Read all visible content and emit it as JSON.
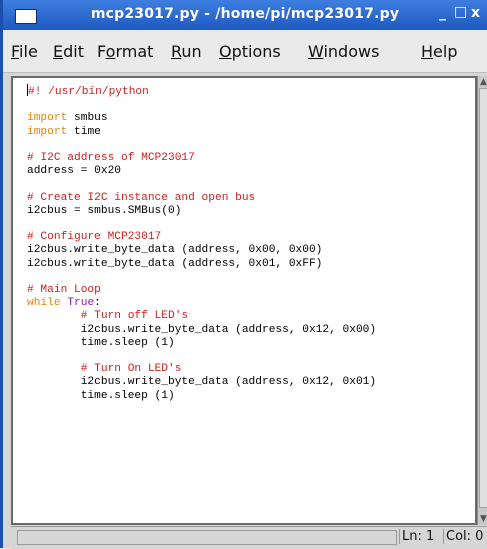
{
  "window": {
    "title": "mcp23017.py - /home/pi/mcp23017.py",
    "controls": {
      "minimize": "_",
      "maximize": "□",
      "close": "x"
    }
  },
  "menu": [
    {
      "label_rest": "ile",
      "mnemonic": "F"
    },
    {
      "label_rest": "dit",
      "mnemonic": "E"
    },
    {
      "label_pre": "F",
      "mnemonic": "o",
      "label_rest": "rmat"
    },
    {
      "label_rest": "un",
      "mnemonic": "R"
    },
    {
      "label_rest": "ptions",
      "mnemonic": "O"
    },
    {
      "label_rest": "indows",
      "mnemonic": "W"
    },
    {
      "label_rest": "elp",
      "mnemonic": "H"
    }
  ],
  "code": {
    "lines": [
      "#! /usr/bin/python",
      "",
      "import smbus",
      "import time",
      "",
      "# I2C address of MCP23017",
      "address = 0x20",
      "",
      "# Create I2C instance and open bus",
      "i2cbus = smbus.SMBus(0)",
      "",
      "# Configure MCP23017",
      "i2cbus.write_byte_data (address, 0x00, 0x00)",
      "i2cbus.write_byte_data (address, 0x01, 0xFF)",
      "",
      "# Main Loop",
      "while True:",
      "        # Turn off LED's",
      "        i2cbus.write_byte_data (address, 0x12, 0x00)",
      "        time.sleep (1)",
      "",
      "        # Turn On LED's",
      "        i2cbus.write_byte_data (address, 0x12, 0x01)",
      "        time.sleep (1)"
    ]
  },
  "status": {
    "line": "Ln: 1",
    "col": "Col: 0"
  },
  "colors": {
    "comment": "#d02020",
    "keyword": "#e8830c",
    "builtin": "#8a1fb0",
    "titlebar": "#2a66d0"
  }
}
